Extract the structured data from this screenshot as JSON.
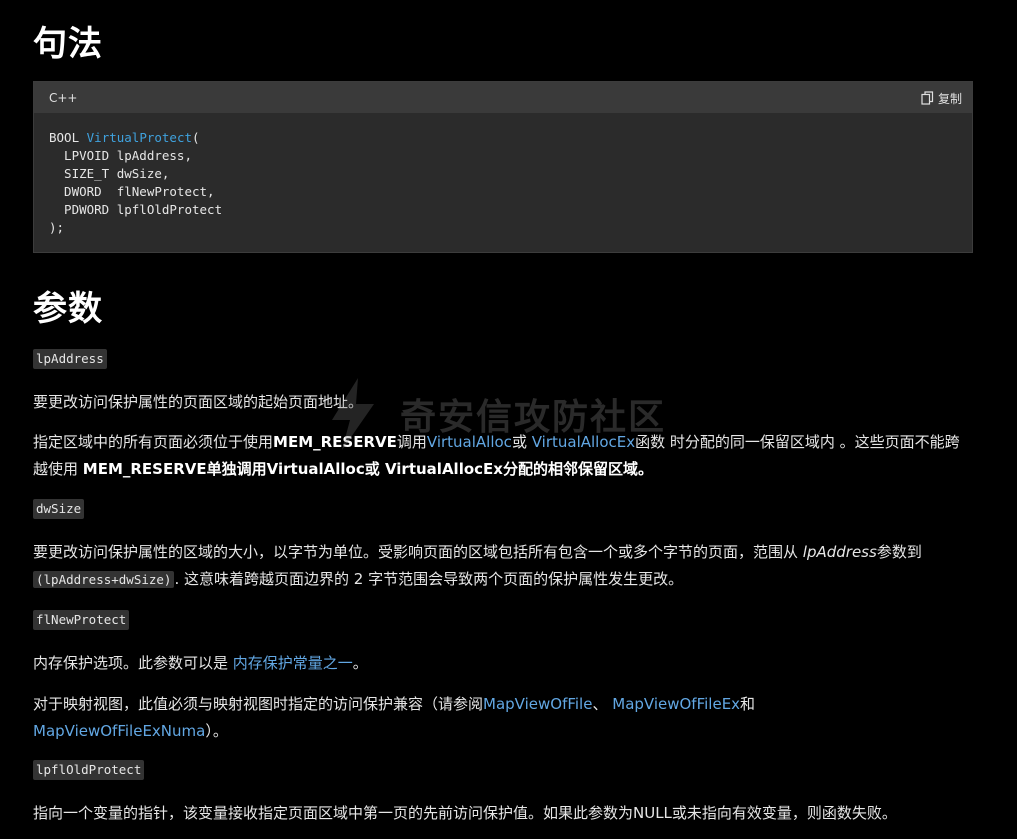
{
  "sections": {
    "syntax_heading": "句法",
    "params_heading": "参数"
  },
  "code_block": {
    "language": "C++",
    "copy_label": "复制",
    "line1_type": "BOOL ",
    "line1_func": "VirtualProtect",
    "line1_rest": "(",
    "lines": [
      "  LPVOID lpAddress,",
      "  SIZE_T dwSize,",
      "  DWORD  flNewProtect,",
      "  PDWORD lpflOldProtect",
      ");"
    ]
  },
  "params": {
    "p1_name": "lpAddress",
    "p1_desc": "要更改访问保护属性的页面区域的起始页面地址。",
    "p1_detail_a": "指定区域中的所有页面必须位于使用",
    "p1_detail_b": "MEM_RESERVE",
    "p1_detail_c": "调用",
    "p1_link1": "VirtualAlloc",
    "p1_detail_d": "或 ",
    "p1_link2": "VirtualAllocEx",
    "p1_detail_e": "函数 时分配的同一保留区域内 。这些页面不能跨越使用 ",
    "p1_detail_f": "MEM_RESERVE单独调用VirtualAlloc或 VirtualAllocEx分配的相邻保留区域。",
    "p2_name": "dwSize",
    "p2_desc_a": "要更改访问保护属性的区域的大小，以字节为单位。受影响页面的区域包括所有包含一个或多个字节的页面，范围从 ",
    "p2_desc_italic": "lpAddress",
    "p2_desc_b": "参数到 ",
    "p2_desc_code": "(lpAddress+dwSize)",
    "p2_desc_c": ". 这意味着跨越页面边界的 2 字节范围会导致两个页面的保护属性发生更改。",
    "p3_name": "flNewProtect",
    "p3_desc_a": "内存保护选项。此参数可以是 ",
    "p3_link": "内存保护常量之一",
    "p3_desc_b": "。",
    "p3_map_a": "对于映射视图，此值必须与映射视图时指定的访问保护兼容（请参阅",
    "p3_map_link1": "MapViewOfFile",
    "p3_map_b": "、 ",
    "p3_map_link2": "MapViewOfFileEx",
    "p3_map_c": "和",
    "p3_map_link3": "MapViewOfFileExNuma",
    "p3_map_d": "）。",
    "p4_name": "lpflOldProtect",
    "p4_desc": "指向一个变量的指针，该变量接收指定页面区域中第一页的先前访问保护值。如果此参数为NULL或未指向有效变量，则函数失败。"
  },
  "watermark": {
    "text": "奇安信攻防社区"
  },
  "colors": {
    "background": "#000000",
    "code_bg": "#2b2b2b",
    "code_header_bg": "#3a3a3a",
    "link": "#62a7e3",
    "func_name": "#3fa2de"
  }
}
